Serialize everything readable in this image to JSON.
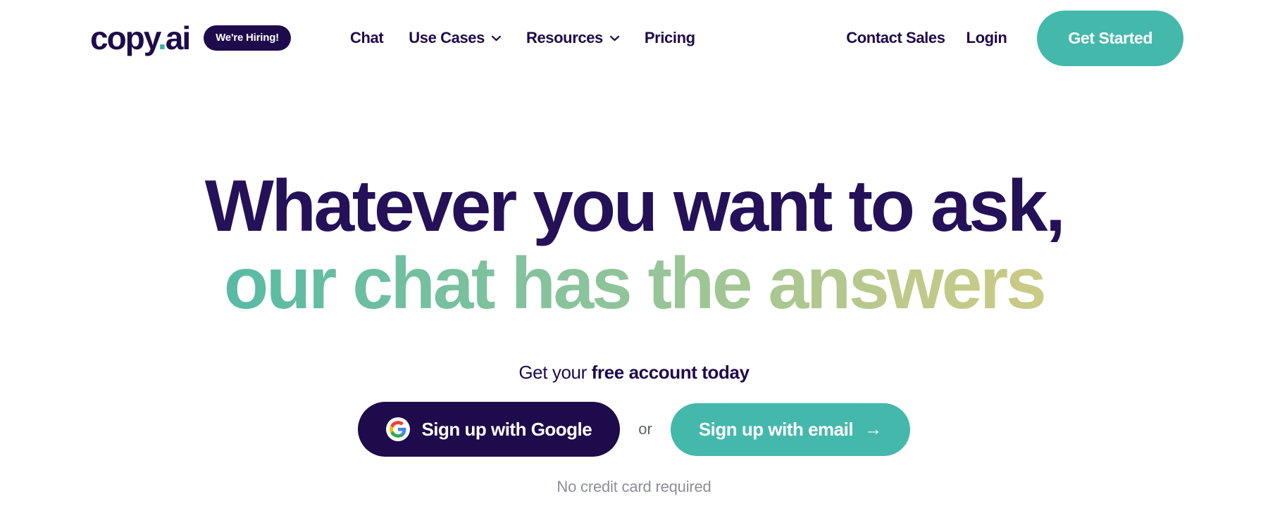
{
  "brand": {
    "logo_text": "copy",
    "logo_dot": ".",
    "logo_suffix": "ai",
    "hiring_badge": "We're Hiring!"
  },
  "nav": {
    "primary": [
      {
        "label": "Chat",
        "has_dropdown": false
      },
      {
        "label": "Use Cases",
        "has_dropdown": true
      },
      {
        "label": "Resources",
        "has_dropdown": true
      },
      {
        "label": "Pricing",
        "has_dropdown": false
      }
    ],
    "secondary": [
      {
        "label": "Contact Sales"
      },
      {
        "label": "Login"
      }
    ],
    "cta_label": "Get Started"
  },
  "hero": {
    "headline_line1": "Whatever you want to ask,",
    "headline_line2": "our chat has the answers",
    "sub_prefix": "Get your ",
    "sub_strong": "free account today",
    "google_button": "Sign up with Google",
    "or_text": "or",
    "email_button": "Sign up with email",
    "email_arrow": "→",
    "fineprint": "No credit card required"
  },
  "colors": {
    "ink": "#1E0B4B",
    "headline": "#241158",
    "teal": "#45B8AC",
    "gradient_start": "#3DB3A6",
    "gradient_end": "#DCCE7D",
    "muted": "#8A8F98",
    "background": "#FFFFFF"
  }
}
